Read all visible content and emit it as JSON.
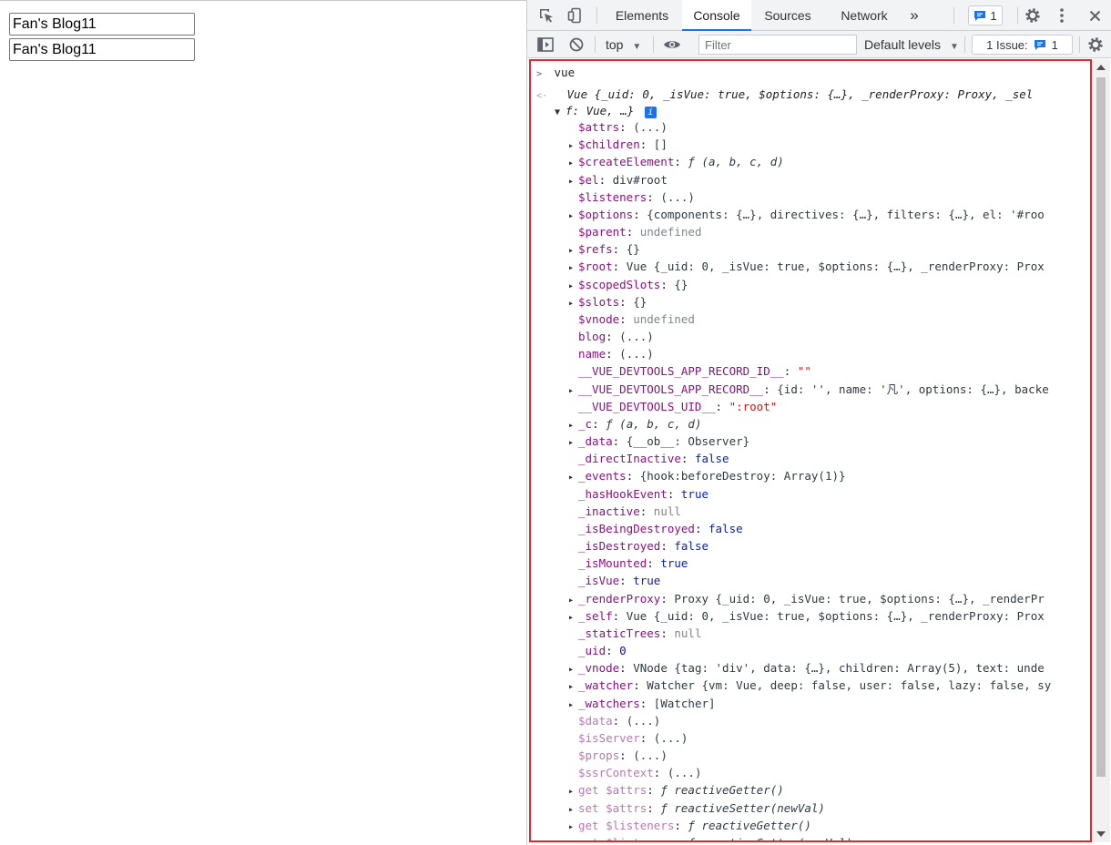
{
  "page": {
    "inputs": [
      "Fan's Blog11",
      "Fan's Blog11"
    ]
  },
  "devtools": {
    "tabs": [
      "Elements",
      "Console",
      "Sources",
      "Network"
    ],
    "active_tab": "Console",
    "more_tabs": "»",
    "messages_count": "1",
    "toolbar": {
      "context": "top",
      "filter_placeholder": "Filter",
      "levels": "Default levels",
      "issues_label": "1 Issue:",
      "issues_count": "1"
    },
    "console": {
      "input": "vue",
      "result_line1": "Vue {_uid: 0, _isVue: true, $options: {…}, _renderProxy: Proxy, _sel",
      "result_line2": "f: Vue, …}",
      "properties": [
        {
          "expand": false,
          "key": "$attrs",
          "val": "(...)",
          "dim": false
        },
        {
          "expand": true,
          "key": "$children",
          "val": "[]",
          "dim": false
        },
        {
          "expand": true,
          "key": "$createElement",
          "val": "ƒ (a, b, c, d)",
          "dim": false
        },
        {
          "expand": true,
          "key": "$el",
          "val": "div#root",
          "dim": false
        },
        {
          "expand": false,
          "key": "$listeners",
          "val": "(...)",
          "dim": false
        },
        {
          "expand": true,
          "key": "$options",
          "val": "{components: {…}, directives: {…}, filters: {…}, el: '#roo",
          "dim": false
        },
        {
          "expand": false,
          "key": "$parent",
          "val": "undefined",
          "dim": false
        },
        {
          "expand": true,
          "key": "$refs",
          "val": "{}",
          "dim": false
        },
        {
          "expand": true,
          "key": "$root",
          "val": "Vue {_uid: 0, _isVue: true, $options: {…}, _renderProxy: Prox",
          "dim": false
        },
        {
          "expand": true,
          "key": "$scopedSlots",
          "val": "{}",
          "dim": false
        },
        {
          "expand": true,
          "key": "$slots",
          "val": "{}",
          "dim": false
        },
        {
          "expand": false,
          "key": "$vnode",
          "val": "undefined",
          "dim": false
        },
        {
          "expand": false,
          "key": "blog",
          "val": "(...)",
          "dim": false
        },
        {
          "expand": false,
          "key": "name",
          "val": "(...)",
          "dim": false
        },
        {
          "expand": false,
          "key": "__VUE_DEVTOOLS_APP_RECORD_ID__",
          "val": "\"\"",
          "dim": false
        },
        {
          "expand": true,
          "key": "__VUE_DEVTOOLS_APP_RECORD__",
          "val": "{id: '', name: '凡', options: {…}, backe",
          "dim": false
        },
        {
          "expand": false,
          "key": "__VUE_DEVTOOLS_UID__",
          "val": "\":root\"",
          "dim": false
        },
        {
          "expand": true,
          "key": "_c",
          "val": "ƒ (a, b, c, d)",
          "dim": false
        },
        {
          "expand": true,
          "key": "_data",
          "val": "{__ob__: Observer}",
          "dim": false
        },
        {
          "expand": false,
          "key": "_directInactive",
          "val": "false",
          "dim": false
        },
        {
          "expand": true,
          "key": "_events",
          "val": "{hook:beforeDestroy: Array(1)}",
          "dim": false
        },
        {
          "expand": false,
          "key": "_hasHookEvent",
          "val": "true",
          "dim": false
        },
        {
          "expand": false,
          "key": "_inactive",
          "val": "null",
          "dim": false
        },
        {
          "expand": false,
          "key": "_isBeingDestroyed",
          "val": "false",
          "dim": false
        },
        {
          "expand": false,
          "key": "_isDestroyed",
          "val": "false",
          "dim": false
        },
        {
          "expand": false,
          "key": "_isMounted",
          "val": "true",
          "dim": false
        },
        {
          "expand": false,
          "key": "_isVue",
          "val": "true",
          "dim": false
        },
        {
          "expand": true,
          "key": "_renderProxy",
          "val": "Proxy {_uid: 0, _isVue: true, $options: {…}, _renderPr",
          "dim": false
        },
        {
          "expand": true,
          "key": "_self",
          "val": "Vue {_uid: 0, _isVue: true, $options: {…}, _renderProxy: Prox",
          "dim": false
        },
        {
          "expand": false,
          "key": "_staticTrees",
          "val": "null",
          "dim": false
        },
        {
          "expand": false,
          "key": "_uid",
          "val": "0",
          "dim": false
        },
        {
          "expand": true,
          "key": "_vnode",
          "val": "VNode {tag: 'div', data: {…}, children: Array(5), text: unde",
          "dim": false
        },
        {
          "expand": true,
          "key": "_watcher",
          "val": "Watcher {vm: Vue, deep: false, user: false, lazy: false, sy",
          "dim": false
        },
        {
          "expand": true,
          "key": "_watchers",
          "val": "[Watcher]",
          "dim": false
        },
        {
          "expand": false,
          "key": "$data",
          "val": "(...)",
          "dim": true
        },
        {
          "expand": false,
          "key": "$isServer",
          "val": "(...)",
          "dim": true
        },
        {
          "expand": false,
          "key": "$props",
          "val": "(...)",
          "dim": true
        },
        {
          "expand": false,
          "key": "$ssrContext",
          "val": "(...)",
          "dim": true
        },
        {
          "expand": true,
          "key": "get $attrs",
          "val": "ƒ reactiveGetter()",
          "dim": true
        },
        {
          "expand": true,
          "key": "set $attrs",
          "val": "ƒ reactiveSetter(newVal)",
          "dim": true
        },
        {
          "expand": true,
          "key": "get $listeners",
          "val": "ƒ reactiveGetter()",
          "dim": true
        },
        {
          "expand": true,
          "key": "set $listeners",
          "val": "ƒ reactiveSetter(newVal)",
          "dim": true
        }
      ]
    }
  }
}
